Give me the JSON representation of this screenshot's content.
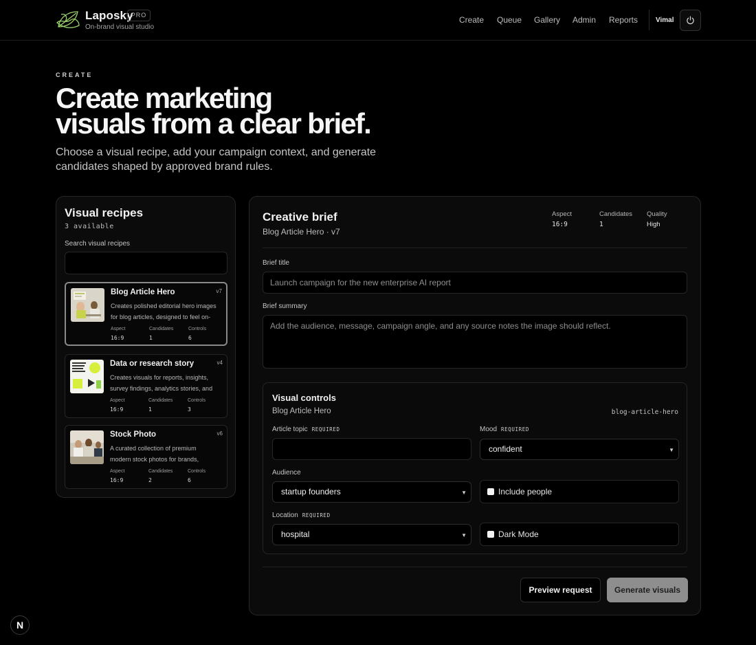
{
  "header": {
    "brand": "Laposky",
    "badge": "PRO",
    "tagline": "On-brand visual studio",
    "nav": [
      "Create",
      "Queue",
      "Gallery",
      "Admin",
      "Reports"
    ],
    "user": "Vimal"
  },
  "hero": {
    "eyebrow": "CREATE",
    "title_line1": "Create marketing",
    "title_line2": "visuals from a clear brief.",
    "lede": "Choose a visual recipe, add your campaign context, and generate candidates shaped by approved brand rules."
  },
  "recipes": {
    "title": "Visual recipes",
    "count": "3 available",
    "search_label": "Search visual recipes",
    "search_value": "",
    "meta_labels": {
      "aspect": "Aspect",
      "candidates": "Candidates",
      "controls": "Controls"
    },
    "items": [
      {
        "name": "Blog Article Hero",
        "version": "v7",
        "desc": "Creates polished editorial hero images for blog articles, designed to feel on-brand and credible.",
        "aspect": "16:9",
        "candidates": "1",
        "controls": "6"
      },
      {
        "name": "Data or research story",
        "version": "v4",
        "desc": "Creates visuals for reports, insights, survey findings, analytics stories, and data narratives.",
        "aspect": "16:9",
        "candidates": "1",
        "controls": "3"
      },
      {
        "name": "Stock Photo",
        "version": "v6",
        "desc": "A curated collection of premium modern stock photos for brands, campaigns and websites.",
        "aspect": "16:9",
        "candidates": "2",
        "controls": "6"
      }
    ]
  },
  "brief": {
    "title": "Creative brief",
    "subtitle": "Blog Article Hero · v7",
    "stats": [
      {
        "label": "Aspect",
        "value": "16:9"
      },
      {
        "label": "Candidates",
        "value": "1"
      },
      {
        "label": "Quality",
        "value": "High"
      }
    ],
    "title_label": "Brief title",
    "title_placeholder": "Launch campaign for the new enterprise AI report",
    "summary_label": "Brief summary",
    "summary_placeholder": "Add the audience, message, campaign angle, and any source notes the image should reflect."
  },
  "controls": {
    "title": "Visual controls",
    "subtitle": "Blog Article Hero",
    "key": "blog-article-hero",
    "required_tag": "REQUIRED",
    "article_topic_label": "Article topic",
    "article_topic_value": "",
    "mood_label": "Mood",
    "mood_value": "confident",
    "audience_label": "Audience",
    "audience_value": "startup founders",
    "include_people_label": "Include people",
    "location_label": "Location",
    "location_value": "hospital",
    "dark_mode_label": "Dark Mode"
  },
  "actions": {
    "preview": "Preview request",
    "generate": "Generate visuals"
  },
  "badge": "N"
}
